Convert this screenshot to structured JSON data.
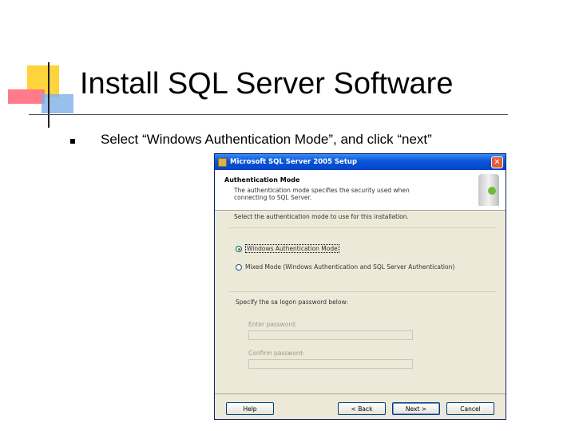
{
  "slide": {
    "title": "Install SQL Server Software",
    "bullet": "Select “Windows Authentication Mode”, and click “next”"
  },
  "dialog": {
    "window_title": "Microsoft SQL Server 2005 Setup",
    "header_title": "Authentication Mode",
    "header_description": "The authentication mode specifies the security used when connecting to SQL Server.",
    "instruction": "Select the authentication mode to use for this installation.",
    "modes": [
      {
        "label": "Windows Authentication Mode",
        "selected": true
      },
      {
        "label": "Mixed Mode (Windows Authentication and SQL Server Authentication)",
        "selected": false
      }
    ],
    "password_section_label": "Specify the sa logon password below:",
    "enter_password_label": "Enter password:",
    "enter_password_value": "",
    "confirm_password_label": "Confirm password:",
    "confirm_password_value": "",
    "buttons": {
      "help": "Help",
      "back": "< Back",
      "next": "Next >",
      "cancel": "Cancel"
    },
    "close_glyph": "✕"
  },
  "colors": {
    "titlebar": "#0a54d8",
    "dialog_background": "#ece9d8",
    "decoration_yellow": "#ffd43a",
    "decoration_pink": "#ff7a8a",
    "decoration_blue": "#7fb0e8"
  },
  "icons": [
    "app-icon",
    "close-icon",
    "setup-graphic-icon"
  ]
}
